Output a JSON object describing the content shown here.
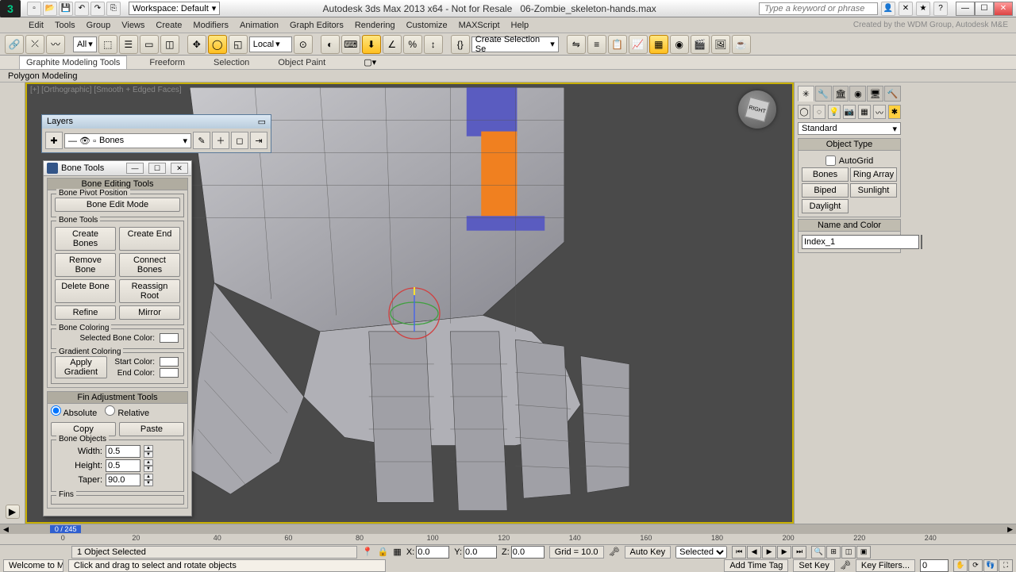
{
  "title": {
    "app": "Autodesk 3ds Max  2013 x64 - Not for Resale",
    "file": "06-Zombie_skeleton-hands.max"
  },
  "workspace_label": "Workspace: Default",
  "search_placeholder": "Type a keyword or phrase",
  "credit": "Created by the WDM Group, Autodesk M&E",
  "menus": [
    "Edit",
    "Tools",
    "Group",
    "Views",
    "Create",
    "Modifiers",
    "Animation",
    "Graph Editors",
    "Rendering",
    "Customize",
    "MAXScript",
    "Help"
  ],
  "toolbar": {
    "filter": "All",
    "ref": "Local",
    "named_sel": "Create Selection Se"
  },
  "ribbon": {
    "tabs": [
      "Graphite Modeling Tools",
      "Freeform",
      "Selection",
      "Object Paint"
    ],
    "sub": "Polygon Modeling"
  },
  "viewport_label": "[+] [Orthographic] [Smooth + Edged Faces]",
  "viewcube_face": "RIGHT",
  "layers": {
    "title": "Layers",
    "current": "Bones"
  },
  "bone_tools": {
    "title": "Bone Tools",
    "rollouts": {
      "edit": {
        "hd": "Bone Editing Tools",
        "pivot_grp": "Bone Pivot Position",
        "edit_mode": "Bone Edit Mode",
        "tools_grp": "Bone Tools",
        "create": "Create Bones",
        "create_end": "Create End",
        "remove": "Remove Bone",
        "connect": "Connect Bones",
        "delete": "Delete Bone",
        "reassign": "Reassign Root",
        "refine": "Refine",
        "mirror": "Mirror",
        "coloring_grp": "Bone Coloring",
        "sel_color": "Selected Bone Color:",
        "grad_grp": "Gradient Coloring",
        "apply_grad": "Apply Gradient",
        "start_c": "Start Color:",
        "end_c": "End Color:"
      },
      "fin": {
        "hd": "Fin Adjustment Tools",
        "abs": "Absolute",
        "rel": "Relative",
        "copy": "Copy",
        "paste": "Paste",
        "obj_grp": "Bone Objects",
        "width_l": "Width:",
        "width_v": "0.5",
        "height_l": "Height:",
        "height_v": "0.5",
        "taper_l": "Taper:",
        "taper_v": "90.0",
        "fins_grp": "Fins"
      }
    }
  },
  "cmd_panel": {
    "category": "Standard",
    "obj_type_hd": "Object Type",
    "autogrid": "AutoGrid",
    "buttons": [
      "Bones",
      "Ring Array",
      "Biped",
      "Sunlight",
      "Daylight"
    ],
    "name_hd": "Name and Color",
    "obj_name": "Index_1"
  },
  "timeline": {
    "frame": "0 / 245",
    "ticks": [
      0,
      20,
      40,
      60,
      80,
      100,
      120,
      140,
      160,
      180,
      200,
      220,
      240
    ]
  },
  "status": {
    "sel": "1 Object Selected",
    "x": "0.0",
    "y": "0.0",
    "z": "0.0",
    "grid": "Grid = 10.0",
    "timetag": "Add Time Tag",
    "autokey": "Auto Key",
    "setkey": "Set Key",
    "key_mode": "Selected",
    "keyfilters": "Key Filters...",
    "frame_cur": "0",
    "welcome": "Welcome to M",
    "prompt": "Click and drag to select and rotate objects"
  }
}
